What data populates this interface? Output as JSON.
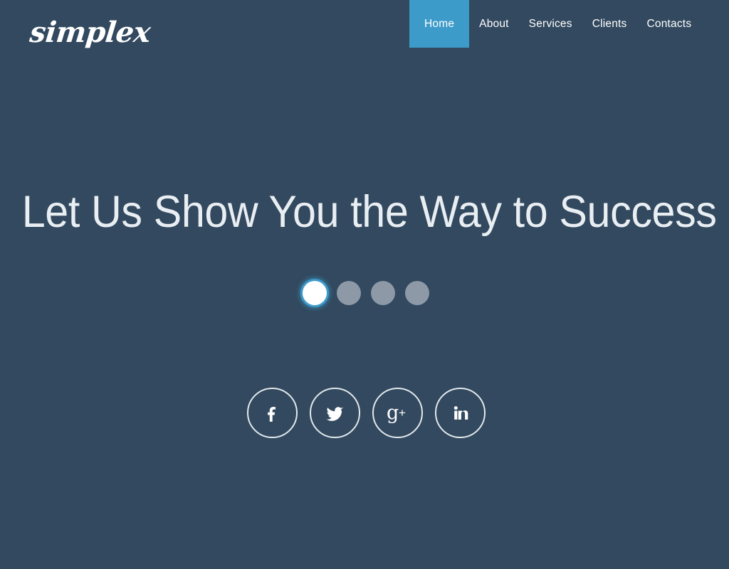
{
  "site": {
    "logo_text": "simplex",
    "background_color": "#32495f",
    "accent_color": "#3d9bc9"
  },
  "nav": {
    "items": [
      {
        "label": "Home",
        "active": true
      },
      {
        "label": "About",
        "active": false
      },
      {
        "label": "Services",
        "active": false
      },
      {
        "label": "Clients",
        "active": false
      },
      {
        "label": "Contacts",
        "active": false
      }
    ]
  },
  "hero": {
    "headline": "Let Us Show You the Way to Success",
    "headline_color": "#e9eef3"
  },
  "slider": {
    "dot_count": 4,
    "active_index": 0,
    "active_color": "#ffffff",
    "inactive_color": "#8d99a6",
    "labels": [
      "slide-1",
      "slide-2",
      "slide-3",
      "slide-4"
    ]
  },
  "socials": {
    "items": [
      {
        "name": "facebook",
        "icon": "facebook-icon",
        "label": "Facebook"
      },
      {
        "name": "twitter",
        "icon": "twitter-icon",
        "label": "Twitter"
      },
      {
        "name": "googleplus",
        "icon": "google-plus-icon",
        "label": "Google Plus"
      },
      {
        "name": "linkedin",
        "icon": "linkedin-icon",
        "label": "LinkedIn"
      }
    ],
    "border_color": "#e3e8ed"
  }
}
